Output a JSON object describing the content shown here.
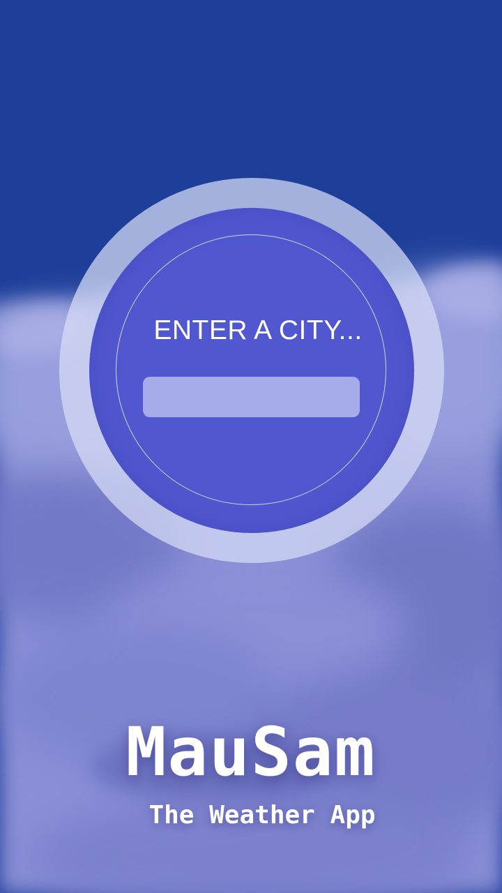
{
  "background": {
    "sky_color": "#1e3f96",
    "cloud_color": "#8087d1",
    "image": "sky-with-clouds"
  },
  "city_search": {
    "prompt": "ENTER A CITY...",
    "value": "",
    "ring_color": "#d7def5",
    "circle_color": "#5157cf"
  },
  "branding": {
    "app_name": "MauSam",
    "tagline": "The Weather App"
  }
}
